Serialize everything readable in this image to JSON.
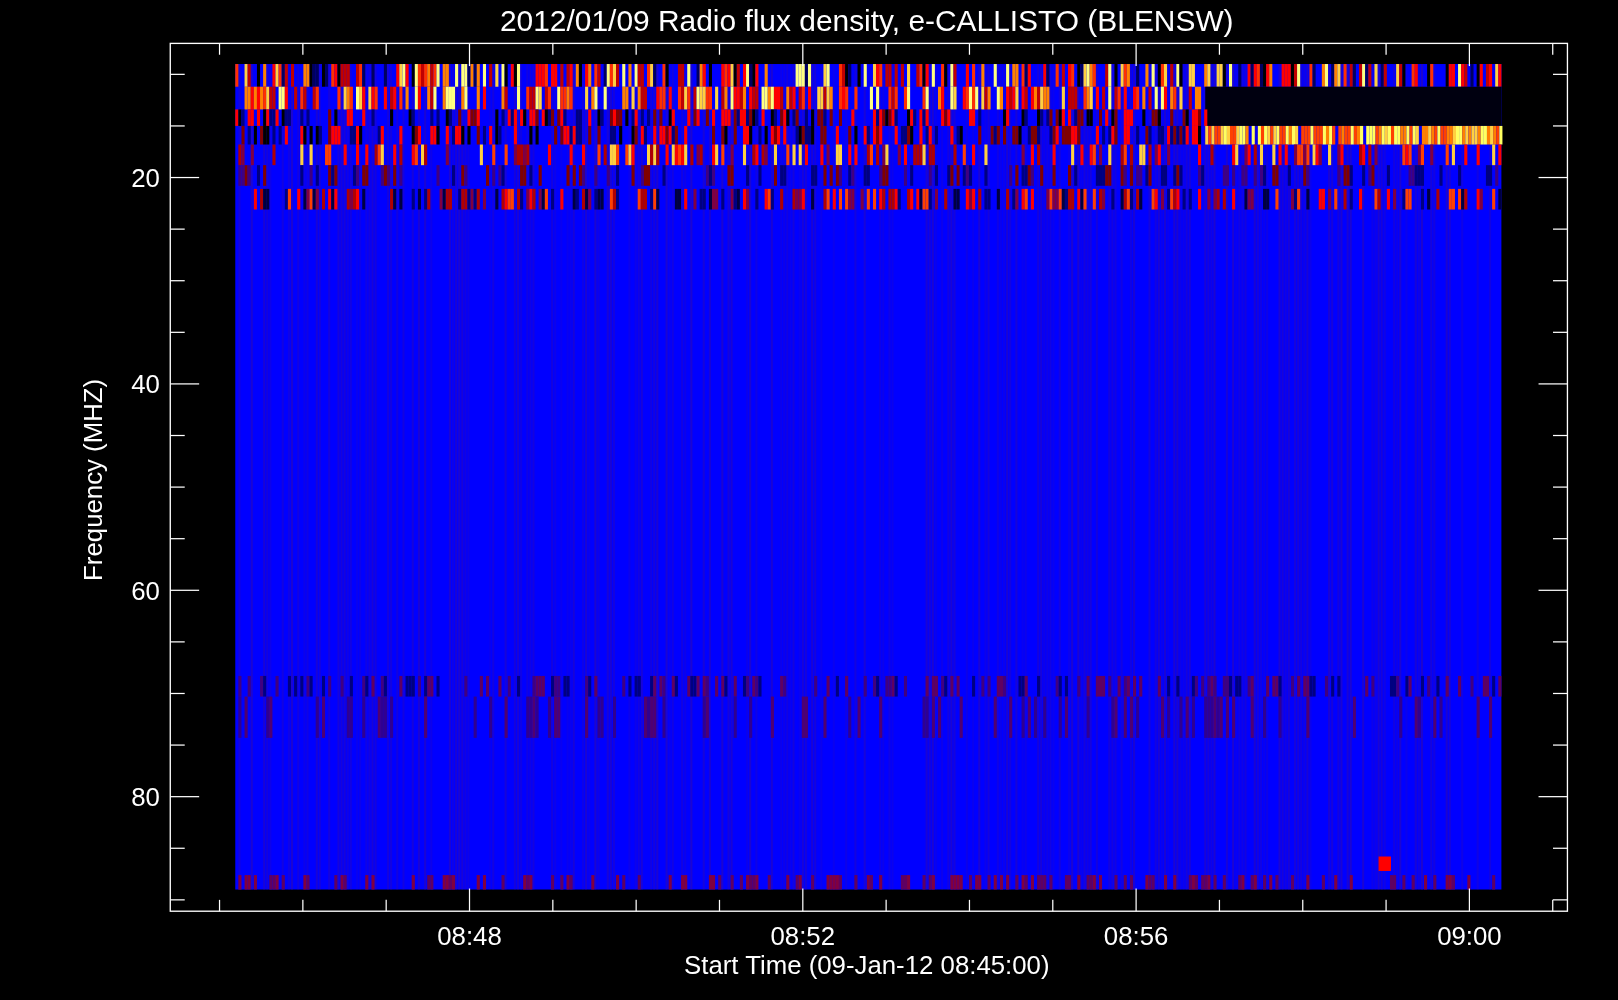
{
  "title": "2012/01/09  Radio flux density, e-CALLISTO (BLENSW)",
  "y_axis": {
    "label": "Frequency (MHZ)",
    "tick_labels": [
      "20",
      "40",
      "60",
      "80"
    ]
  },
  "x_axis": {
    "label": "Start Time (09-Jan-12 08:45:00)",
    "tick_labels": [
      "08:48",
      "08:52",
      "08:56",
      "09:00"
    ]
  }
}
